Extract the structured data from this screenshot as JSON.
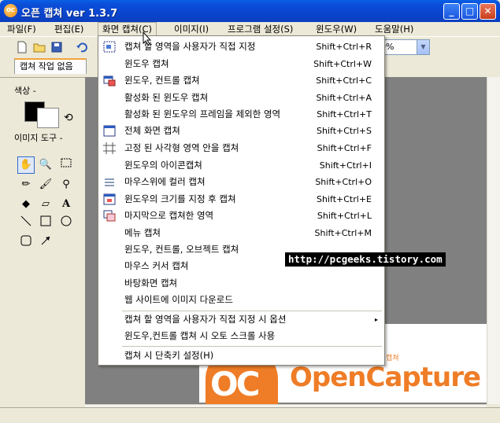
{
  "window": {
    "title": "오픈 캡쳐 ver 1.3.7",
    "app_icon_text": "OC",
    "minimize": "_",
    "maximize": "□",
    "close": "✕"
  },
  "menubar": [
    {
      "label": "파일(F)"
    },
    {
      "label": "편집(E)"
    },
    {
      "label": "화면 캡쳐(C)"
    },
    {
      "label": "이미지(I)"
    },
    {
      "label": "프로그램 설정(S)"
    },
    {
      "label": "윈도우(W)"
    },
    {
      "label": "도움말(H)"
    }
  ],
  "toolbar": {
    "zoom_value": "0%"
  },
  "tab": {
    "label": "캡쳐 작업 없음"
  },
  "left_panel": {
    "color_label": "색상 -",
    "tools_label": "이미지 도구 -"
  },
  "capture_menu": [
    {
      "label": "캡쳐 할 영역을 사용자가 직접 지정",
      "shortcut": "Shift+Ctrl+R",
      "icon": "region-icon"
    },
    {
      "label": "윈도우 캡쳐",
      "shortcut": "Shift+Ctrl+W",
      "icon": ""
    },
    {
      "label": "윈도우, 컨트롤 캡쳐",
      "shortcut": "Shift+Ctrl+C",
      "icon": "window-control-icon"
    },
    {
      "label": "활성화 된 윈도우 캡쳐",
      "shortcut": "Shift+Ctrl+A",
      "icon": ""
    },
    {
      "label": "활성화 된 윈도우의 프레임을 제외한 영역",
      "shortcut": "Shift+Ctrl+T",
      "icon": ""
    },
    {
      "label": "전체 화면 캡쳐",
      "shortcut": "Shift+Ctrl+S",
      "icon": "fullscreen-icon"
    },
    {
      "label": "고정 된 사각형 영역 안을 캡쳐",
      "shortcut": "Shift+Ctrl+F",
      "icon": "fixed-rect-icon"
    },
    {
      "label": "윈도우의 아이콘캡쳐",
      "shortcut": "Shift+Ctrl+I",
      "icon": ""
    },
    {
      "label": "마우스위에 컬러 캡쳐",
      "shortcut": "Shift+Ctrl+O",
      "icon": "color-capture-icon"
    },
    {
      "label": "윈도우의 크기를 지정 후 캡쳐",
      "shortcut": "Shift+Ctrl+E",
      "icon": "resize-window-icon"
    },
    {
      "label": "마지막으로 캡쳐한 영역",
      "shortcut": "Shift+Ctrl+L",
      "icon": "last-region-icon"
    },
    {
      "label": "메뉴 캡쳐",
      "shortcut": "Shift+Ctrl+M",
      "icon": ""
    },
    {
      "label": "윈도우, 컨트롤, 오브젝트 캡쳐",
      "shortcut": "",
      "icon": ""
    },
    {
      "label": "마우스 커서 캡쳐",
      "shortcut": "",
      "icon": ""
    },
    {
      "label": "바탕화면 캡쳐",
      "shortcut": "",
      "icon": ""
    },
    {
      "label": "웹 사이트에 이미지 다운로드",
      "shortcut": "",
      "icon": ""
    }
  ],
  "capture_menu_bottom": [
    {
      "label": "캡쳐 할 영역을 사용자가 직접 지정 시 옵션",
      "arrow": "▸"
    },
    {
      "label": "윈도우,컨트롤 캡쳐 시 오토 스크롤 사용"
    },
    {
      "label": "캡쳐 시 단축키 설정(H)"
    }
  ],
  "canvas": {
    "watermark": "http://pcgeeks.tistory.com",
    "logo_text": "OpenCapture",
    "logo_mark": "OC",
    "logo_small": "캡쳐"
  }
}
